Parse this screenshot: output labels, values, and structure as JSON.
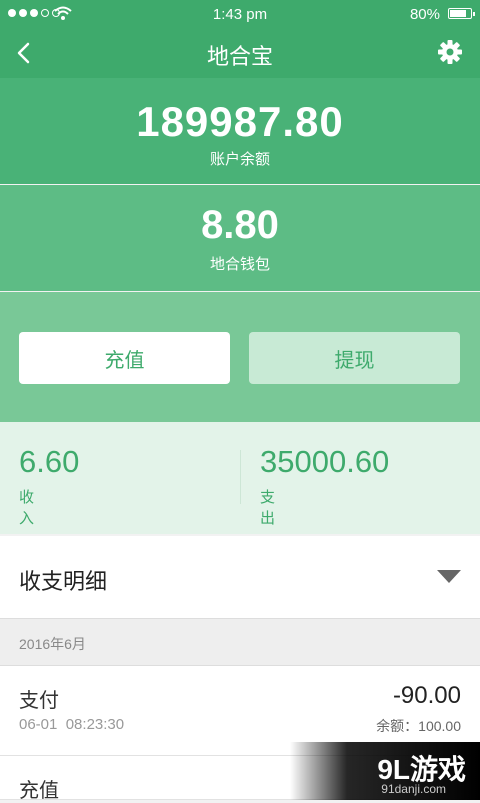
{
  "status_bar": {
    "time": "1:43 pm",
    "battery_text": "80%",
    "battery_level": 0.8,
    "signal_bars_filled": 3,
    "signal_bars_total": 5
  },
  "header": {
    "title": "地合宝",
    "back_icon": "chevron-left-icon",
    "settings_icon": "gear-icon"
  },
  "account": {
    "balance": "189987.80",
    "balance_label": "账户余额",
    "wallet": "8.80",
    "wallet_label": "地合钱包"
  },
  "actions": {
    "charge_label": "充值",
    "withdraw_label": "提现"
  },
  "summary": {
    "income": "6.60",
    "income_label": "收入",
    "expense": "35000.60",
    "expense_label": "支出"
  },
  "detail": {
    "title": "收支明细",
    "month": "2016年6月"
  },
  "transactions": [
    {
      "type": "支付",
      "date": "06-01",
      "time": "08:23:30",
      "amount": "-90.00",
      "balance": "余额：100.00"
    },
    {
      "type": "充值"
    }
  ],
  "watermark": {
    "brand": "9L游戏",
    "url": "91danji.com"
  },
  "colors": {
    "primary": "#3eaa6c",
    "balance_bg": "#49b277",
    "wallet_bg": "#5dbc85",
    "actions_bg": "#79c897",
    "summary_bg": "#e3f3e9"
  }
}
